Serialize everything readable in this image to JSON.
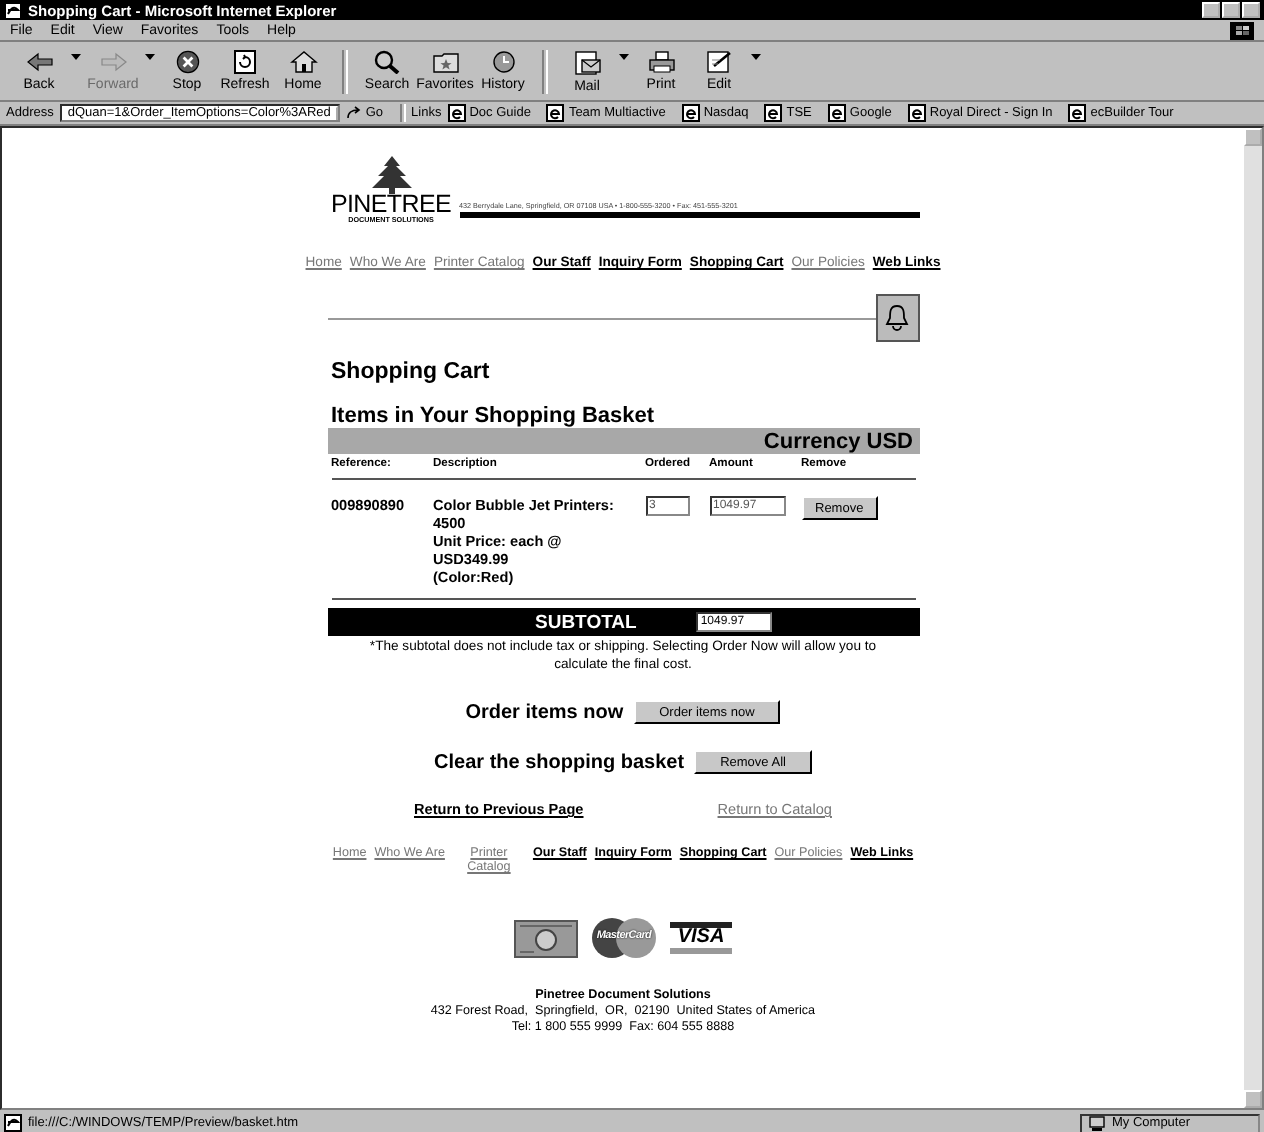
{
  "window": {
    "title": "Shopping Cart - Microsoft Internet Explorer"
  },
  "menu": [
    "File",
    "Edit",
    "View",
    "Favorites",
    "Tools",
    "Help"
  ],
  "toolbar": [
    [
      {
        "label": "Back",
        "disabled": false,
        "dropdown": true
      },
      {
        "label": "Forward",
        "disabled": true,
        "dropdown": true
      },
      {
        "label": "Stop",
        "disabled": false,
        "dropdown": false
      },
      {
        "label": "Refresh",
        "disabled": false,
        "dropdown": false
      },
      {
        "label": "Home",
        "disabled": false,
        "dropdown": false
      }
    ],
    [
      {
        "label": "Search",
        "disabled": false,
        "dropdown": false
      },
      {
        "label": "Favorites",
        "disabled": false,
        "dropdown": false
      },
      {
        "label": "History",
        "disabled": false,
        "dropdown": false
      }
    ],
    [
      {
        "label": "Mail",
        "disabled": false,
        "dropdown": true
      },
      {
        "label": "Print",
        "disabled": false,
        "dropdown": false
      },
      {
        "label": "Edit",
        "disabled": false,
        "dropdown": true
      }
    ]
  ],
  "address": {
    "label": "Address",
    "value": "dQuan=1&Order_ItemOptions=Color%3ARed",
    "go": "Go"
  },
  "links": {
    "label": "Links",
    "items": [
      "Doc Guide",
      "Team Multiactive",
      "Nasdaq",
      "TSE",
      "Google",
      "Royal Direct - Sign In",
      "ecBuilder Tour"
    ]
  },
  "page": {
    "logo": {
      "name": "PINETREE",
      "subtitle": "DOCUMENT SOLUTIONS",
      "contact": "432 Berrydale Lane, Springfield, OR  07108  USA • 1-800-555-3200 • Fax: 451-555-3201"
    },
    "nav": [
      {
        "label": "Home",
        "visited": true
      },
      {
        "label": "Who We Are",
        "visited": true
      },
      {
        "label": "Printer Catalog",
        "visited": true
      },
      {
        "label": "Our Staff",
        "visited": false
      },
      {
        "label": "Inquiry Form",
        "visited": false
      },
      {
        "label": "Shopping Cart",
        "visited": false
      },
      {
        "label": "Our Policies",
        "visited": true
      },
      {
        "label": "Web Links",
        "visited": false
      }
    ],
    "heading": "Shopping Cart",
    "subheading": "Items in Your Shopping Basket",
    "currency": "Currency USD",
    "columns": [
      "Reference:",
      "Description",
      "Ordered",
      "Amount",
      "Remove"
    ],
    "rows": [
      {
        "reference": "009890890",
        "description": [
          "Color Bubble Jet Printers: 4500",
          "Unit Price: each @ USD349.99",
          "(Color:Red)"
        ],
        "ordered": "3",
        "amount": "1049.97",
        "button": "Remove"
      }
    ],
    "subtotal": {
      "label": "SUBTOTAL",
      "value": "1049.97"
    },
    "note": "*The subtotal does not include tax or shipping. Selecting Order Now will allow you to calculate the final cost.",
    "actions": [
      {
        "label": "Order items now",
        "button": "Order items now"
      },
      {
        "label": "Clear the shopping basket",
        "button": "Remove All"
      }
    ],
    "return_links": [
      {
        "label": "Return to Previous Page",
        "visited": false
      },
      {
        "label": "Return to Catalog",
        "visited": true
      }
    ],
    "footer_nav": [
      {
        "label": "Home",
        "visited": true
      },
      {
        "label": "Who We Are",
        "visited": true
      },
      {
        "label": "Printer Catalog",
        "visited": true
      },
      {
        "label": "Our Staff",
        "visited": false
      },
      {
        "label": "Inquiry Form",
        "visited": false
      },
      {
        "label": "Shopping Cart",
        "visited": false
      },
      {
        "label": "Our Policies",
        "visited": true
      },
      {
        "label": "Web Links",
        "visited": false
      }
    ],
    "cards": [
      {
        "kind": "amex"
      },
      {
        "kind": "mastercard",
        "text": "MasterCard"
      },
      {
        "kind": "visa",
        "text": "VISA"
      }
    ],
    "company": "Pinetree Document Solutions",
    "company_address": "432 Forest Road,  Springfield,  OR,  02190  United States of America",
    "company_phone": "Tel: 1 800 555 9999  Fax: 604 555 8888"
  },
  "status_bar": {
    "url": "file:///C:/WINDOWS/TEMP/Preview/basket.htm",
    "zone": "My Computer"
  }
}
